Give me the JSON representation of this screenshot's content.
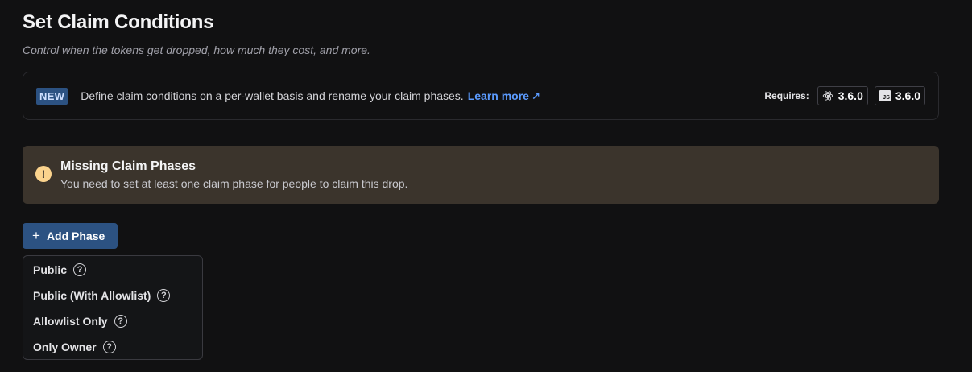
{
  "header": {
    "title": "Set Claim Conditions",
    "subtitle": "Control when the tokens get dropped, how much they cost, and more."
  },
  "notice": {
    "badge": "NEW",
    "text": "Define claim conditions on a per-wallet basis and rename your claim phases.",
    "link_label": "Learn more",
    "link_arrow": "↗",
    "requires_label": "Requires:",
    "requirements": [
      {
        "icon": "react-icon",
        "version": "3.6.0"
      },
      {
        "icon": "js-icon",
        "icon_text": "JS",
        "version": "3.6.0"
      }
    ]
  },
  "warning": {
    "icon": "!",
    "title": "Missing Claim Phases",
    "description": "You need to set at least one claim phase for people to claim this drop.",
    "background_color": "#3b342c",
    "icon_color": "#fbd38d"
  },
  "add_phase": {
    "plus": "+",
    "label": "Add Phase",
    "color": "#2c5282"
  },
  "phase_menu": {
    "help_glyph": "?",
    "items": [
      {
        "label": "Public"
      },
      {
        "label": "Public (With Allowlist)"
      },
      {
        "label": "Allowlist Only"
      },
      {
        "label": "Only Owner"
      }
    ]
  }
}
